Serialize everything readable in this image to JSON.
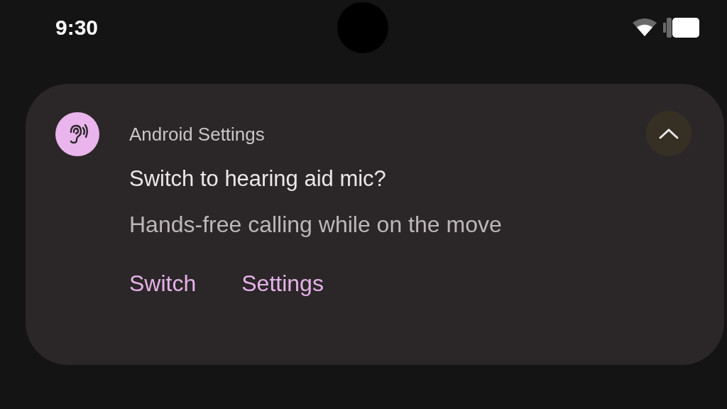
{
  "status_bar": {
    "time": "9:30"
  },
  "notification": {
    "app_name": "Android Settings",
    "expanded": true,
    "title": "Switch to hearing aid mic?",
    "text": "Hands-free calling while on the move",
    "actions": [
      {
        "label": "Switch"
      },
      {
        "label": "Settings"
      }
    ]
  }
}
